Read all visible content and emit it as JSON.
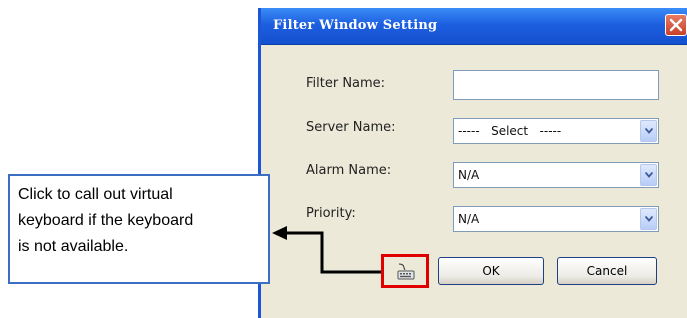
{
  "dialog": {
    "title": "Filter Window Setting",
    "filter_name_label": "Filter Name:",
    "filter_name_value": "",
    "server_name_label": "Server Name:",
    "server_name_value": "-----   Select   -----",
    "alarm_name_label": "Alarm Name:",
    "alarm_name_value": "N/A",
    "priority_label": "Priority:",
    "priority_value": "N/A",
    "ok_label": "OK",
    "cancel_label": "Cancel"
  },
  "callout": {
    "lines": [
      "Click to call out virtual",
      "keyboard if the keyboard",
      "is not available."
    ]
  },
  "icons": {
    "close": "close-icon",
    "dropdown": "chevron-down-icon",
    "keyboard": "keyboard-icon"
  },
  "colors": {
    "titlebar": "#1d5fe0",
    "close_button": "#c8402a",
    "highlight_box": "#e00000",
    "callout_border": "#3a6fc4",
    "dialog_bg": "#ece9d8"
  }
}
